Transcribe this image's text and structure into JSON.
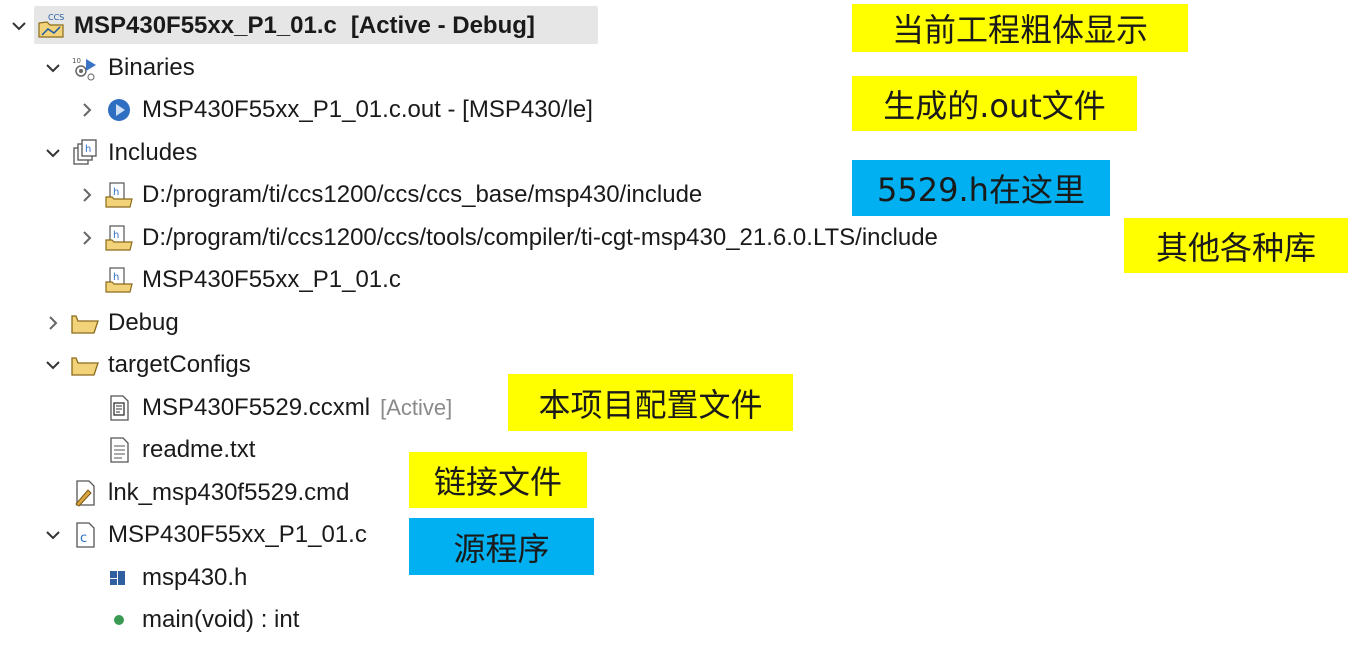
{
  "tree": {
    "project": {
      "name": "MSP430F55xx_P1_01.c",
      "status": "[Active - Debug]",
      "icon": "ccs-project-icon"
    },
    "binaries": {
      "label": "Binaries",
      "out_file": "MSP430F55xx_P1_01.c.out - [MSP430/le]"
    },
    "includes": {
      "label": "Includes",
      "paths": [
        "D:/program/ti/ccs1200/ccs/ccs_base/msp430/include",
        "D:/program/ti/ccs1200/ccs/tools/compiler/ti-cgt-msp430_21.6.0.LTS/include",
        "MSP430F55xx_P1_01.c"
      ]
    },
    "debug": {
      "label": "Debug"
    },
    "target_configs": {
      "label": "targetConfigs",
      "ccxml": "MSP430F5529.ccxml",
      "ccxml_status": "[Active]",
      "readme": "readme.txt"
    },
    "cmd_file": "lnk_msp430f5529.cmd",
    "source": {
      "label": "MSP430F55xx_P1_01.c",
      "header": "msp430.h",
      "function": "main(void) : int"
    }
  },
  "annotations": {
    "current_project_bold": "当前工程粗体显示",
    "generated_out": "生成的.out文件",
    "h_file_here": "5529.h在这里",
    "other_libs": "其他各种库",
    "project_config": "本项目配置文件",
    "link_file": "链接文件",
    "source_program": "源程序"
  },
  "colors": {
    "highlight_yellow": "#ffff00",
    "highlight_blue": "#00b0f0",
    "selection": "#e6e6e6"
  }
}
